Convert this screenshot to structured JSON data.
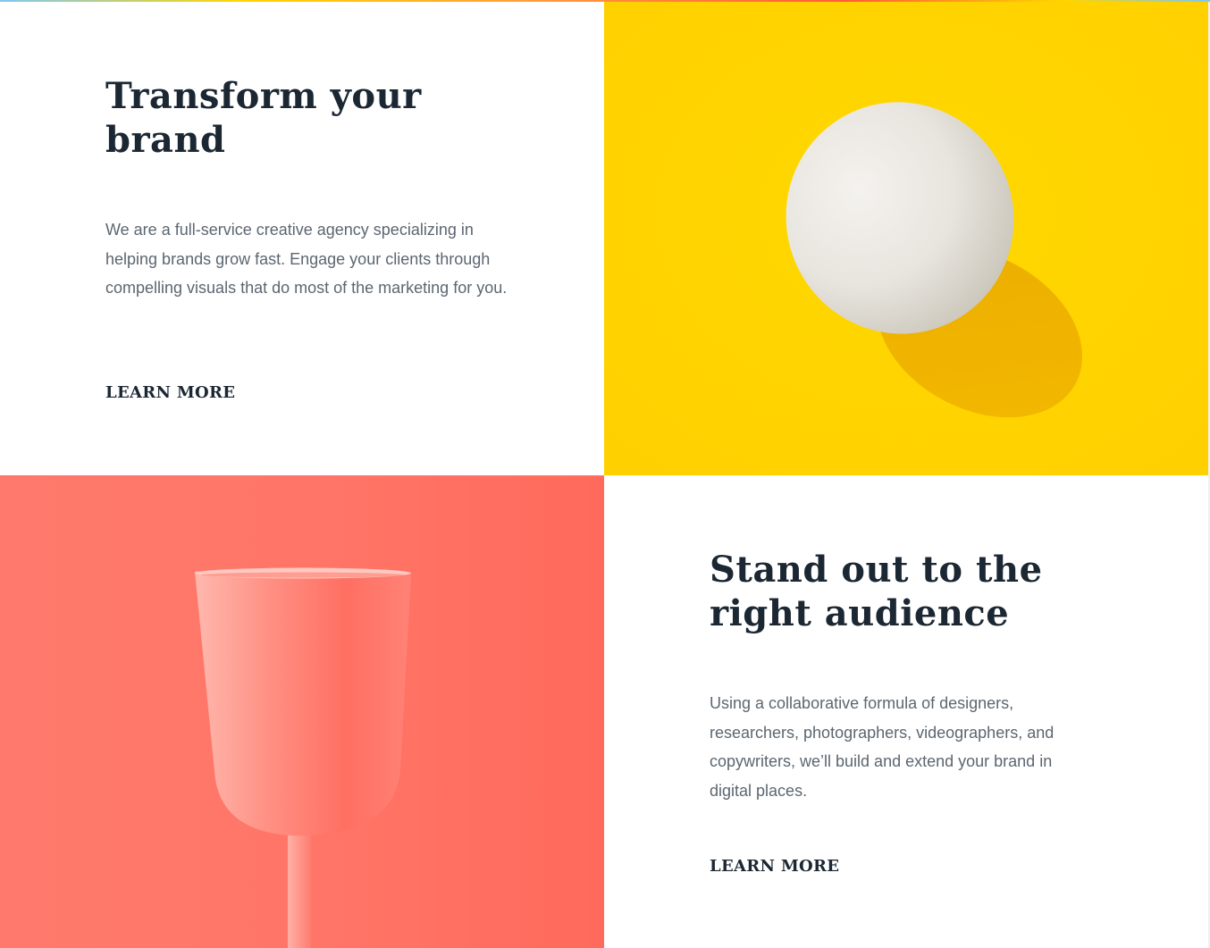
{
  "sections": {
    "transform": {
      "title_line1": "Transform your",
      "title_line2": "brand",
      "body": "We are a full-service creative agency specializing in helping brands grow fast. Engage your clients through compelling visuals that do most of the marketing for you.",
      "cta_label": "LEARN MORE",
      "cta_underline_color": "#fff1a8"
    },
    "egg_image": {
      "background_color": "#ffd400",
      "icon": "egg-photo"
    },
    "cup_image": {
      "background_color": "#ff7466",
      "icon": "cup-photo"
    },
    "stand_out": {
      "title_line1": "Stand out to the",
      "title_line2": "right audience",
      "body": "Using a collaborative formula of designers, researchers, photographers, videographers, and copywriters, we’ll build and extend your brand in digital places.",
      "cta_label": "LEARN MORE",
      "cta_underline_color": "#ffd3cd"
    }
  },
  "colors": {
    "heading": "#1b2733",
    "body": "#5c6670",
    "yellow": "#ffd400",
    "coral": "#ff7466"
  }
}
